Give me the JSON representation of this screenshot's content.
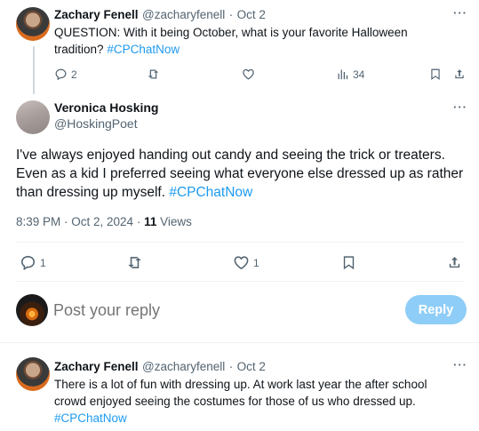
{
  "tweet1": {
    "author_name": "Zachary Fenell",
    "handle": "@zacharyfenell",
    "separator": "·",
    "date": "Oct 2",
    "text_line1": "QUESTION: With it being October, what is your favorite Halloween",
    "text_line2": "tradition?",
    "hashtag": "#CPChatNow",
    "replies": "2",
    "views": "34"
  },
  "main_tweet": {
    "author_name": "Veronica Hosking",
    "handle": "@HoskingPoet",
    "line1": "I've always enjoyed handing out candy and seeing the trick or treaters.",
    "line2": "Even as a kid I preferred seeing what everyone else dressed up as rather",
    "line3": "than dressing up myself.",
    "hashtag": "#CPChatNow",
    "timestamp": "8:39 PM · Oct 2, 2024 ·",
    "views_count": "11",
    "views_label": "Views",
    "replies": "1",
    "likes": "1"
  },
  "composer": {
    "placeholder": "Post your reply",
    "button_label": "Reply"
  },
  "tweet3": {
    "author_name": "Zachary Fenell",
    "handle": "@zacharyfenell",
    "separator": "·",
    "date": "Oct 2",
    "text_line1": "There is a lot of fun with dressing up. At work last year the after school",
    "text_line2": "crowd enjoyed seeing the costumes for those of us who dressed up.",
    "hashtag": "#CPChatNow"
  },
  "colors": {
    "accent": "#1d9bf0",
    "muted": "#536471",
    "reply_button": "#8ecdf7"
  }
}
